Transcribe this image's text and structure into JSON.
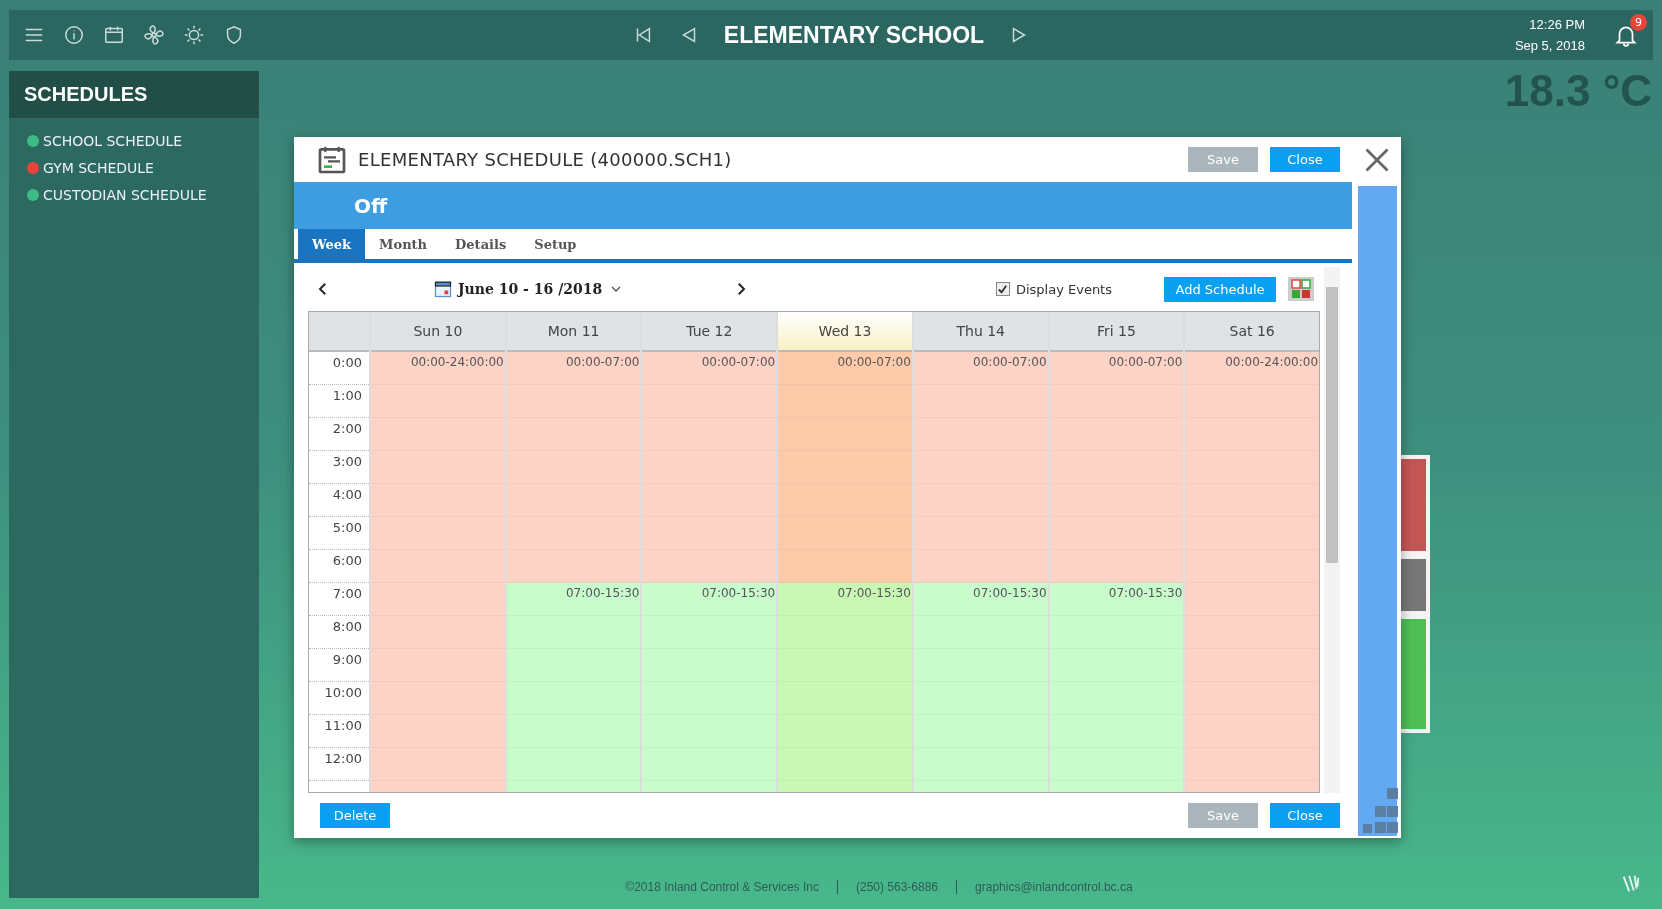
{
  "top_bar": {
    "title": "ELEMENTARY SCHOOL",
    "time": "12:26 PM",
    "date": "Sep 5, 2018",
    "notification_count": "9"
  },
  "temperature": "18.3 °C",
  "sidebar": {
    "title": "SCHEDULES",
    "items": [
      {
        "label": "SCHOOL SCHEDULE",
        "color": "#3dbb85"
      },
      {
        "label": "GYM SCHEDULE",
        "color": "#e8443a"
      },
      {
        "label": "CUSTODIAN SCHEDULE",
        "color": "#3dbb85"
      }
    ]
  },
  "dialog": {
    "title": "ELEMENTARY SCHEDULE (400000.SCH1)",
    "status": "Off",
    "header_buttons": [
      {
        "label": "Save",
        "disabled": true
      },
      {
        "label": "Close",
        "disabled": false
      }
    ],
    "tabs": [
      {
        "label": "Week",
        "selected": true
      },
      {
        "label": "Month",
        "selected": false
      },
      {
        "label": "Details",
        "selected": false
      },
      {
        "label": "Setup",
        "selected": false
      }
    ],
    "date_range": "June 10 - 16 /2018",
    "display_events": {
      "label": "Display Events",
      "checked": true
    },
    "add_button": "Add Schedule",
    "hours": [
      "0:00",
      "1:00",
      "2:00",
      "3:00",
      "4:00",
      "5:00",
      "6:00",
      "7:00",
      "8:00",
      "9:00",
      "10:00",
      "11:00",
      "12:00"
    ],
    "days": [
      {
        "label": "Sun 10",
        "today": false,
        "events": [
          {
            "label": "00:00-24:00:00",
            "kind": "off"
          }
        ]
      },
      {
        "label": "Mon 11",
        "today": false,
        "events": [
          {
            "label": "00:00-07:00",
            "kind": "off"
          },
          {
            "label": "07:00-15:30",
            "kind": "on"
          }
        ]
      },
      {
        "label": "Tue 12",
        "today": false,
        "events": [
          {
            "label": "00:00-07:00",
            "kind": "off"
          },
          {
            "label": "07:00-15:30",
            "kind": "on"
          }
        ]
      },
      {
        "label": "Wed 13",
        "today": true,
        "events": [
          {
            "label": "00:00-07:00",
            "kind": "off"
          },
          {
            "label": "07:00-15:30",
            "kind": "on"
          }
        ]
      },
      {
        "label": "Thu 14",
        "today": false,
        "events": [
          {
            "label": "00:00-07:00",
            "kind": "off"
          },
          {
            "label": "07:00-15:30",
            "kind": "on"
          }
        ]
      },
      {
        "label": "Fri 15",
        "today": false,
        "events": [
          {
            "label": "00:00-07:00",
            "kind": "off"
          },
          {
            "label": "07:00-15:30",
            "kind": "on"
          }
        ]
      },
      {
        "label": "Sat 16",
        "today": false,
        "events": [
          {
            "label": "00:00-24:00:00",
            "kind": "off"
          }
        ]
      }
    ],
    "footer_buttons": [
      {
        "label": "Delete",
        "disabled": false
      },
      {
        "label": "Save",
        "disabled": true
      },
      {
        "label": "Close",
        "disabled": false
      }
    ]
  },
  "footer": [
    "©2018 Inland Control & Services Inc",
    "(250) 563-6886",
    "graphics@inlandcontrol.bc.ca"
  ]
}
